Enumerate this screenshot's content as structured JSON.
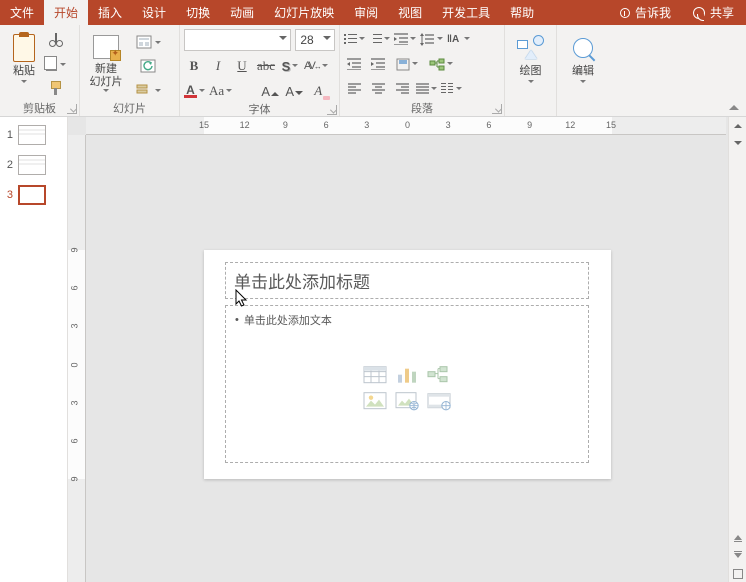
{
  "tabs": {
    "file": "文件",
    "home": "开始",
    "insert": "插入",
    "design": "设计",
    "transitions": "切换",
    "animations": "动画",
    "slideshow": "幻灯片放映",
    "review": "审阅",
    "view": "视图",
    "developer": "开发工具",
    "help": "帮助"
  },
  "tellme": "告诉我",
  "share": "共享",
  "groups": {
    "clipboard": {
      "label": "剪贴板",
      "paste": "粘贴"
    },
    "slides": {
      "label": "幻灯片",
      "newslide": "新建\n幻灯片"
    },
    "font": {
      "label": "字体",
      "size": "28"
    },
    "paragraph": {
      "label": "段落"
    },
    "draw": {
      "label": "绘图"
    },
    "edit": {
      "label": "编辑"
    }
  },
  "fontbuttons": {
    "bold": "B",
    "italic": "I",
    "underline": "U",
    "strike": "S",
    "shadow": "S",
    "charspace": "AV",
    "changecase": "Aa",
    "color": "A",
    "highlight": "A",
    "clear": "A",
    "grow": "A",
    "shrink": "A"
  },
  "ruler_h": [
    "15",
    "12",
    "9",
    "6",
    "3",
    "0",
    "3",
    "6",
    "9",
    "12",
    "15"
  ],
  "ruler_v": [
    "9",
    "6",
    "3",
    "0",
    "3",
    "6",
    "9"
  ],
  "thumbs": [
    "1",
    "2",
    "3"
  ],
  "slide": {
    "title_placeholder": "单击此处添加标题",
    "content_placeholder": "单击此处添加文本"
  }
}
